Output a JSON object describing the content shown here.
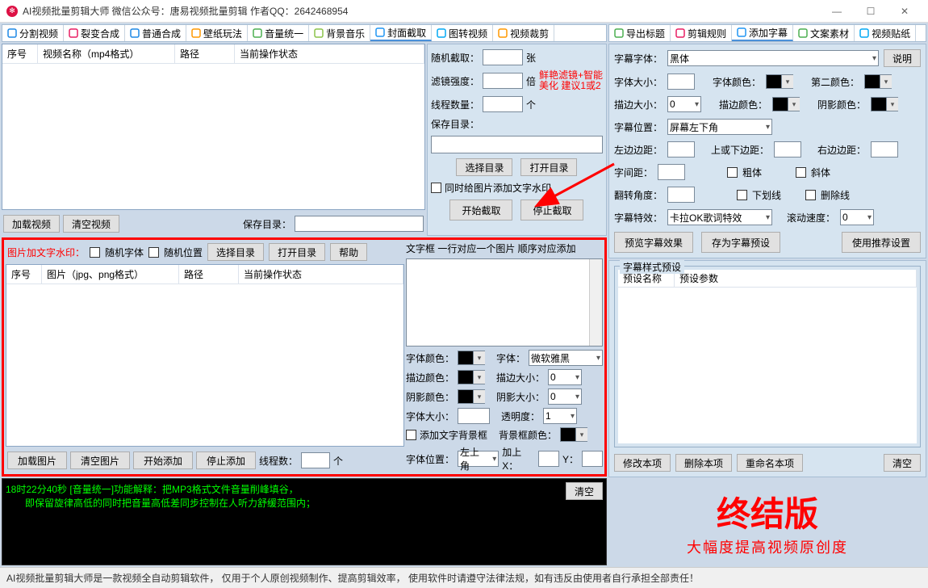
{
  "titlebar": {
    "title": "AI视频批量剪辑大师    微信公众号：唐易视频批量剪辑    作者QQ：2642468954"
  },
  "tabs_left": [
    {
      "icon": "#1e88e5",
      "label": "分割视频"
    },
    {
      "icon": "#e91e63",
      "label": "裂变合成"
    },
    {
      "icon": "#1e88e5",
      "label": "普通合成"
    },
    {
      "icon": "#ff9800",
      "label": "壁纸玩法"
    },
    {
      "icon": "#4caf50",
      "label": "音量统一"
    },
    {
      "icon": "#8bc34a",
      "label": "背景音乐"
    },
    {
      "icon": "#2196f3",
      "label": "封面截取",
      "active": true
    },
    {
      "icon": "#03a9f4",
      "label": "图转视频"
    },
    {
      "icon": "#ff9800",
      "label": "视频裁剪"
    }
  ],
  "tabs_right": [
    {
      "icon": "#4caf50",
      "label": "导出标题"
    },
    {
      "icon": "#e91e63",
      "label": "剪辑规则"
    },
    {
      "icon": "#2196f3",
      "label": "添加字幕",
      "active": true
    },
    {
      "icon": "#4caf50",
      "label": "文案素材"
    },
    {
      "icon": "#03a9f4",
      "label": "视频贴纸"
    }
  ],
  "video_table": {
    "cols": [
      "序号",
      "视频名称（mp4格式）",
      "路径",
      "当前操作状态"
    ]
  },
  "video_btns": {
    "load": "加载视频",
    "clear": "清空视频",
    "save_dir_label": "保存目录："
  },
  "capture": {
    "rand_label": "随机截取：",
    "rand_unit": "张",
    "filter_label": "滤镜强度：",
    "filter_unit": "倍",
    "filter_hint1": "鲜艳滤镜+智能",
    "filter_hint2": "美化 建议1或2",
    "thread_label": "线程数量：",
    "thread_unit": "个",
    "save_label": "保存目录：",
    "choose_dir": "选择目录",
    "open_dir": "打开目录",
    "add_wm_cb": "同时给图片添加文字水印",
    "start": "开始截取",
    "stop": "停止截取"
  },
  "wm": {
    "title": "图片加文字水印：",
    "rand_font": "随机字体",
    "rand_pos": "随机位置",
    "choose_dir": "选择目录",
    "open_dir": "打开目录",
    "help": "帮助"
  },
  "img_table": {
    "cols": [
      "序号",
      "图片（jpg、png格式）",
      "路径",
      "当前操作状态"
    ]
  },
  "img_btns": {
    "load": "加载图片",
    "clear": "清空图片",
    "start": "开始添加",
    "stop": "停止添加",
    "threads_label": "线程数：",
    "threads_unit": "个"
  },
  "textbox": {
    "hint": "文字框 一行对应一个图片 顺序对应添加",
    "font_color": "字体颜色：",
    "font": "字体：",
    "font_val": "微软雅黑",
    "stroke_color": "描边颜色：",
    "stroke_size": "描边大小：",
    "stroke_val": "0",
    "shadow_color": "阴影颜色：",
    "shadow_size": "阴影大小：",
    "shadow_val": "0",
    "font_size": "字体大小：",
    "opacity": "透明度：",
    "opacity_val": "1",
    "add_bg": "添加文字背景框",
    "bg_color": "背景框颜色：",
    "pos": "字体位置：",
    "pos_val": "左上角",
    "addx": "加上X：",
    "y": "Y："
  },
  "right": {
    "explain_btn": "说明",
    "font_label": "字幕字体：",
    "font_val": "黑体",
    "size_label": "字体大小：",
    "color_label": "字体颜色：",
    "second_color": "第二颜色：",
    "stroke_label": "描边大小：",
    "stroke_val": "0",
    "stroke_color": "描边颜色：",
    "shadow_color": "阴影颜色：",
    "pos_label": "字幕位置：",
    "pos_val": "屏幕左下角",
    "left_margin": "左边边距：",
    "tb_margin": "上或下边距：",
    "right_margin": "右边边距：",
    "spacing": "字间距：",
    "bold": "粗体",
    "italic": "斜体",
    "rotate": "翻转角度：",
    "underline": "下划线",
    "strike": "删除线",
    "effect": "字幕特效：",
    "effect_val": "卡拉OK歌词特效",
    "scroll": "滚动速度：",
    "scroll_val": "0",
    "preview": "预览字幕效果",
    "save_preset": "存为字幕预设",
    "use_rec": "使用推荐设置",
    "preset_group": "字幕样式预设",
    "preset_cols": [
      "预设名称",
      "预设参数"
    ],
    "modify": "修改本项",
    "delete": "删除本项",
    "rename": "重命名本项",
    "clear": "清空"
  },
  "promo": {
    "big": "终结版",
    "sub": "大幅度提高视频原创度"
  },
  "log": {
    "line1": "18时22分40秒 [音量统一]功能解释：把MP3格式文件音量削峰填谷，",
    "line2": "即保留旋律高低的同时把音量高低差同步控制在人听力舒缓范围内；",
    "clear": "清空"
  },
  "status": "AI视频批量剪辑大师是一款视频全自动剪辑软件，   仅用于个人原创视频制作、提高剪辑效率，  使用软件时请遵守法律法规，如有违反由使用者自行承担全部责任！"
}
